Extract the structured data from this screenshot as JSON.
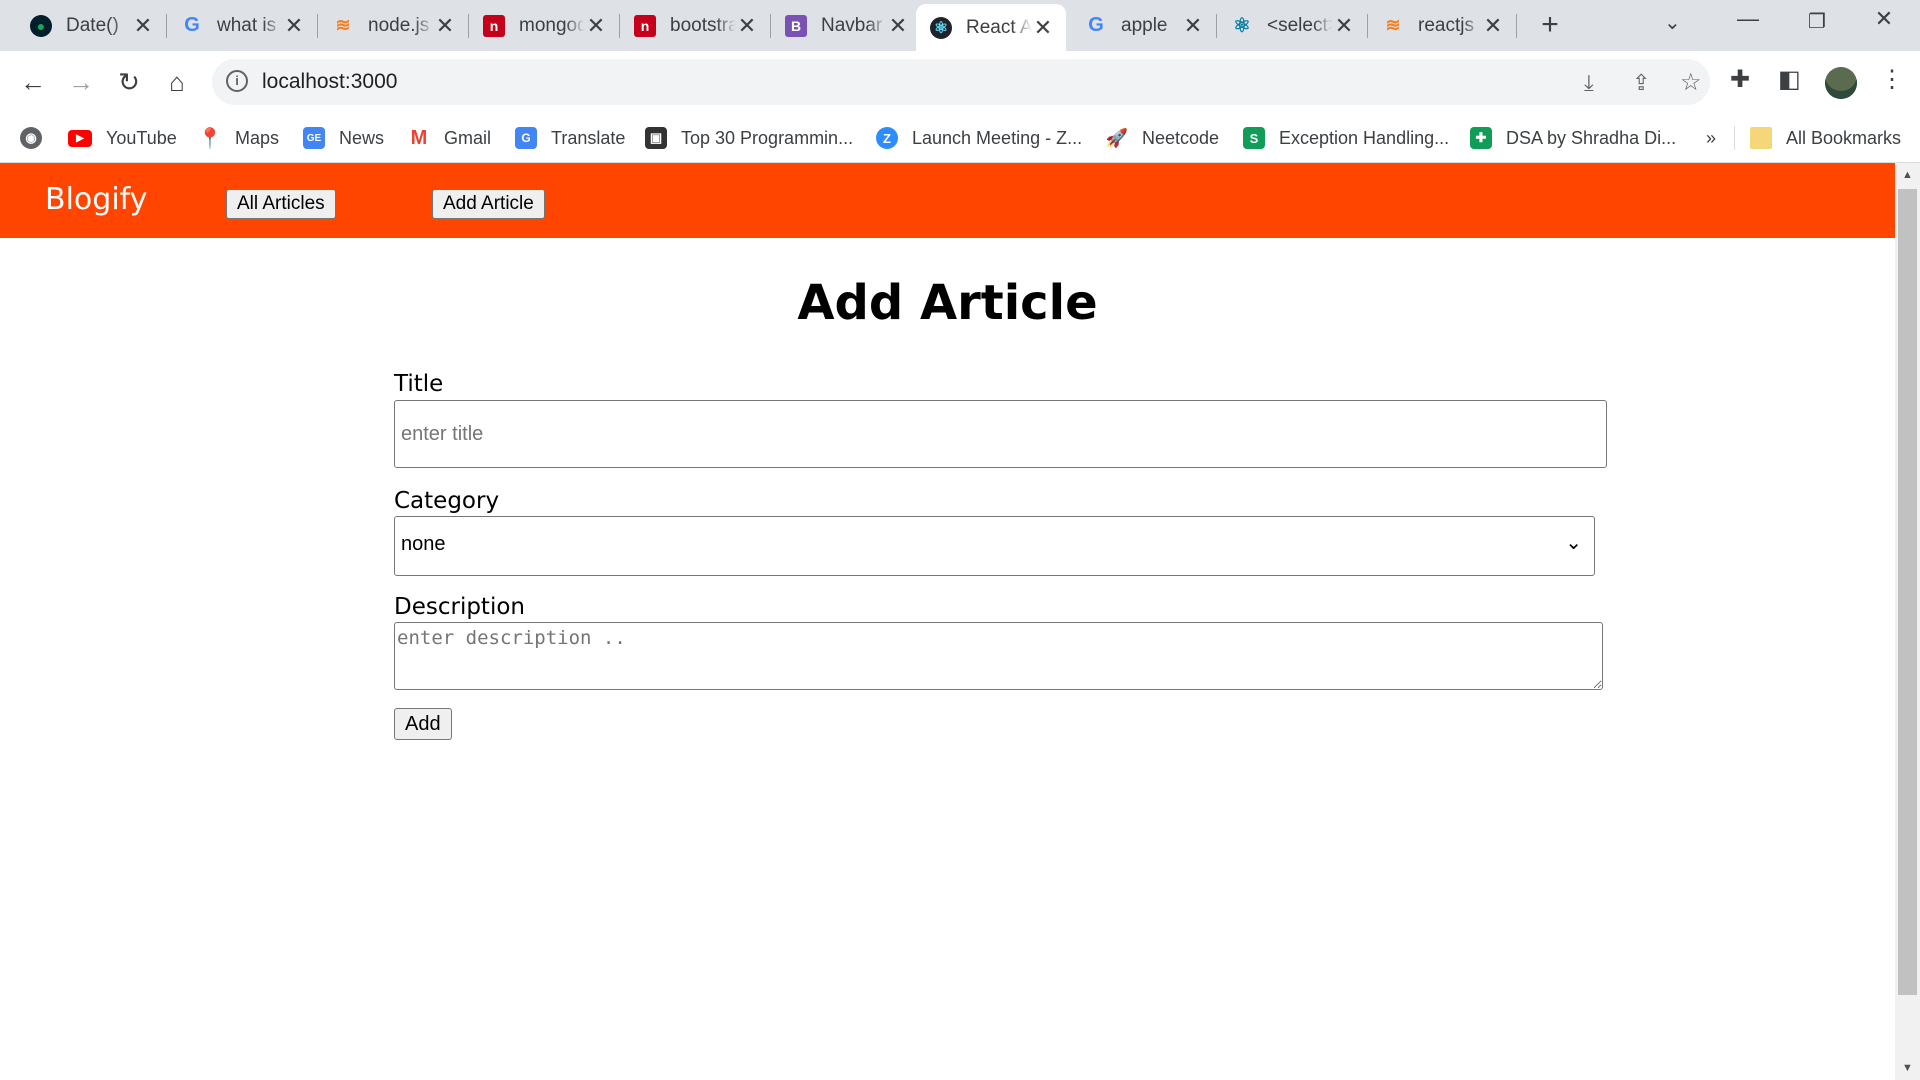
{
  "browser": {
    "tabs": [
      {
        "label": "Date()",
        "icon": "mongodb-leaf-icon",
        "color": "#13aa52"
      },
      {
        "label": "what is",
        "icon": "google-icon",
        "color": "#4285f4"
      },
      {
        "label": "node.js",
        "icon": "stackoverflow-icon",
        "color": "#f48024"
      },
      {
        "label": "mongodb",
        "icon": "n-logo-icon",
        "color": "#c4001a"
      },
      {
        "label": "bootstrap",
        "icon": "n-logo-icon",
        "color": "#c4001a"
      },
      {
        "label": "Navbar",
        "icon": "bootstrap-icon",
        "color": "#7952b3"
      },
      {
        "label": "React App",
        "icon": "react-icon",
        "color": "#61dafb",
        "active": true
      },
      {
        "label": "apple",
        "icon": "google-icon",
        "color": "#4285f4"
      },
      {
        "label": "<select>",
        "icon": "react-icon",
        "color": "#087ea4"
      },
      {
        "label": "reactjs",
        "icon": "stackoverflow-icon",
        "color": "#f48024"
      }
    ],
    "url": "localhost:3000",
    "bookmarks": [
      {
        "label": "YouTube",
        "icon": "youtube-icon",
        "color": "#ff0000"
      },
      {
        "label": "Maps",
        "icon": "maps-pin-icon",
        "color": "#34a853"
      },
      {
        "label": "News",
        "icon": "google-news-icon",
        "color": "#4285f4"
      },
      {
        "label": "Gmail",
        "icon": "gmail-icon",
        "color": "#ea4335"
      },
      {
        "label": "Translate",
        "icon": "translate-icon",
        "color": "#4285f4"
      },
      {
        "label": "Top 30 Programmin...",
        "icon": "book-cube-icon",
        "color": "#333333"
      },
      {
        "label": "Launch Meeting - Z...",
        "icon": "zoom-icon",
        "color": "#2d8cff"
      },
      {
        "label": "Neetcode",
        "icon": "rocket-icon",
        "color": "#555555"
      },
      {
        "label": "Exception Handling...",
        "icon": "s-logo-icon",
        "color": "#0f9d58"
      },
      {
        "label": "DSA by Shradha Di...",
        "icon": "sheets-icon",
        "color": "#0f9d58"
      }
    ],
    "bookmarks_overflow": "»",
    "all_bookmarks": "All Bookmarks"
  },
  "app": {
    "brand": "Blogify",
    "brand_color": "#ff4500",
    "nav": {
      "all_articles": "All Articles",
      "add_article": "Add Article"
    },
    "page_title": "Add Article",
    "form": {
      "title_label": "Title",
      "title_placeholder": "enter title",
      "category_label": "Category",
      "category_value": "none",
      "description_label": "Description",
      "description_placeholder": "enter description ..",
      "submit_label": "Add"
    }
  }
}
